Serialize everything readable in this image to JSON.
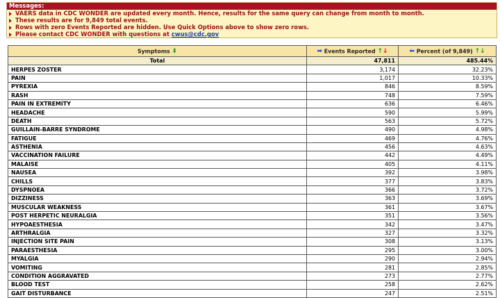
{
  "messages": {
    "title": "Messages:",
    "lines": [
      "VAERS data in CDC WONDER are updated every month. Hence, results for the same query can change from month to month.",
      "These results are for 9,849 total events.",
      "Rows with zero Events Reported are hidden. Use Quick Options above to show zero rows."
    ],
    "contact_prefix": "Please contact CDC WONDER with questions at ",
    "contact_link": "cwus@cdc.gov"
  },
  "table": {
    "headers": {
      "symptoms": "Symptoms",
      "events": "Events Reported",
      "percent": "Percent (of 9,849)"
    },
    "total": {
      "label": "Total",
      "events": "47,811",
      "percent": "485.44%"
    },
    "rows": [
      {
        "symptom": "HERPES ZOSTER",
        "events": "3,174",
        "percent": "32.23%"
      },
      {
        "symptom": "PAIN",
        "events": "1,017",
        "percent": "10.33%"
      },
      {
        "symptom": "PYREXIA",
        "events": "846",
        "percent": "8.59%"
      },
      {
        "symptom": "RASH",
        "events": "748",
        "percent": "7.59%"
      },
      {
        "symptom": "PAIN IN EXTREMITY",
        "events": "636",
        "percent": "6.46%"
      },
      {
        "symptom": "HEADACHE",
        "events": "590",
        "percent": "5.99%"
      },
      {
        "symptom": "DEATH",
        "events": "563",
        "percent": "5.72%"
      },
      {
        "symptom": "GUILLAIN-BARRE SYNDROME",
        "events": "490",
        "percent": "4.98%"
      },
      {
        "symptom": "FATIGUE",
        "events": "469",
        "percent": "4.76%"
      },
      {
        "symptom": "ASTHENIA",
        "events": "456",
        "percent": "4.63%"
      },
      {
        "symptom": "VACCINATION FAILURE",
        "events": "442",
        "percent": "4.49%"
      },
      {
        "symptom": "MALAISE",
        "events": "405",
        "percent": "4.11%"
      },
      {
        "symptom": "NAUSEA",
        "events": "392",
        "percent": "3.98%"
      },
      {
        "symptom": "CHILLS",
        "events": "377",
        "percent": "3.83%"
      },
      {
        "symptom": "DYSPNOEA",
        "events": "366",
        "percent": "3.72%"
      },
      {
        "symptom": "DIZZINESS",
        "events": "363",
        "percent": "3.69%"
      },
      {
        "symptom": "MUSCULAR WEAKNESS",
        "events": "361",
        "percent": "3.67%"
      },
      {
        "symptom": "POST HERPETIC NEURALGIA",
        "events": "351",
        "percent": "3.56%"
      },
      {
        "symptom": "HYPOAESTHESIA",
        "events": "342",
        "percent": "3.47%"
      },
      {
        "symptom": "ARTHRALGIA",
        "events": "327",
        "percent": "3.32%"
      },
      {
        "symptom": "INJECTION SITE PAIN",
        "events": "308",
        "percent": "3.13%"
      },
      {
        "symptom": "PARAESTHESIA",
        "events": "295",
        "percent": "3.00%"
      },
      {
        "symptom": "MYALGIA",
        "events": "290",
        "percent": "2.94%"
      },
      {
        "symptom": "VOMITING",
        "events": "281",
        "percent": "2.85%"
      },
      {
        "symptom": "CONDITION AGGRAVATED",
        "events": "273",
        "percent": "2.77%"
      },
      {
        "symptom": "BLOOD TEST",
        "events": "258",
        "percent": "2.62%"
      },
      {
        "symptom": "GAIT DISTURBANCE",
        "events": "247",
        "percent": "2.51%"
      }
    ]
  },
  "icons": {
    "sort_down": "sort-down-icon",
    "move_right": "move-right-arrow-icon",
    "sort_up_down": "sort-up-down-icon",
    "move_left": "move-left-arrow-icon"
  },
  "colors": {
    "message_header_bg": "#a8131d",
    "message_text": "#a0121a",
    "message_bg": "#fdf6c4",
    "header_bg": "#f8e4a4",
    "link": "#1f3fa8"
  }
}
